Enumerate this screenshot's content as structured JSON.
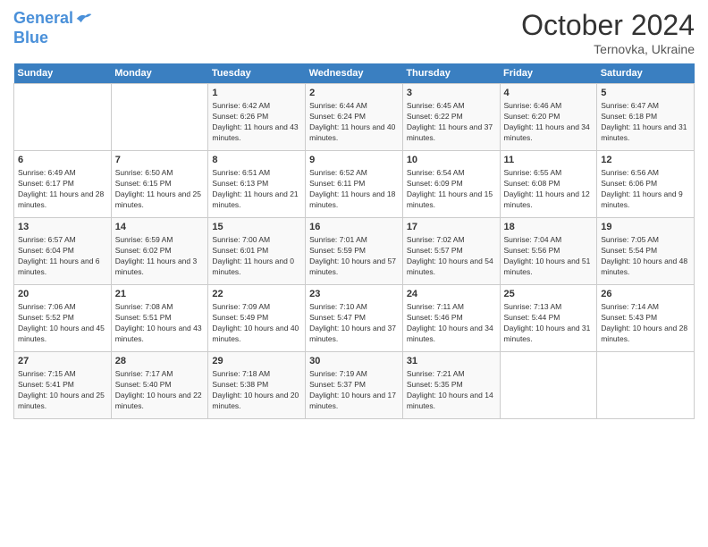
{
  "header": {
    "logo_line1": "General",
    "logo_line2": "Blue",
    "month": "October 2024",
    "location": "Ternovka, Ukraine"
  },
  "days_of_week": [
    "Sunday",
    "Monday",
    "Tuesday",
    "Wednesday",
    "Thursday",
    "Friday",
    "Saturday"
  ],
  "weeks": [
    [
      {
        "day": "",
        "info": ""
      },
      {
        "day": "",
        "info": ""
      },
      {
        "day": "1",
        "info": "Sunrise: 6:42 AM\nSunset: 6:26 PM\nDaylight: 11 hours and 43 minutes."
      },
      {
        "day": "2",
        "info": "Sunrise: 6:44 AM\nSunset: 6:24 PM\nDaylight: 11 hours and 40 minutes."
      },
      {
        "day": "3",
        "info": "Sunrise: 6:45 AM\nSunset: 6:22 PM\nDaylight: 11 hours and 37 minutes."
      },
      {
        "day": "4",
        "info": "Sunrise: 6:46 AM\nSunset: 6:20 PM\nDaylight: 11 hours and 34 minutes."
      },
      {
        "day": "5",
        "info": "Sunrise: 6:47 AM\nSunset: 6:18 PM\nDaylight: 11 hours and 31 minutes."
      }
    ],
    [
      {
        "day": "6",
        "info": "Sunrise: 6:49 AM\nSunset: 6:17 PM\nDaylight: 11 hours and 28 minutes."
      },
      {
        "day": "7",
        "info": "Sunrise: 6:50 AM\nSunset: 6:15 PM\nDaylight: 11 hours and 25 minutes."
      },
      {
        "day": "8",
        "info": "Sunrise: 6:51 AM\nSunset: 6:13 PM\nDaylight: 11 hours and 21 minutes."
      },
      {
        "day": "9",
        "info": "Sunrise: 6:52 AM\nSunset: 6:11 PM\nDaylight: 11 hours and 18 minutes."
      },
      {
        "day": "10",
        "info": "Sunrise: 6:54 AM\nSunset: 6:09 PM\nDaylight: 11 hours and 15 minutes."
      },
      {
        "day": "11",
        "info": "Sunrise: 6:55 AM\nSunset: 6:08 PM\nDaylight: 11 hours and 12 minutes."
      },
      {
        "day": "12",
        "info": "Sunrise: 6:56 AM\nSunset: 6:06 PM\nDaylight: 11 hours and 9 minutes."
      }
    ],
    [
      {
        "day": "13",
        "info": "Sunrise: 6:57 AM\nSunset: 6:04 PM\nDaylight: 11 hours and 6 minutes."
      },
      {
        "day": "14",
        "info": "Sunrise: 6:59 AM\nSunset: 6:02 PM\nDaylight: 11 hours and 3 minutes."
      },
      {
        "day": "15",
        "info": "Sunrise: 7:00 AM\nSunset: 6:01 PM\nDaylight: 11 hours and 0 minutes."
      },
      {
        "day": "16",
        "info": "Sunrise: 7:01 AM\nSunset: 5:59 PM\nDaylight: 10 hours and 57 minutes."
      },
      {
        "day": "17",
        "info": "Sunrise: 7:02 AM\nSunset: 5:57 PM\nDaylight: 10 hours and 54 minutes."
      },
      {
        "day": "18",
        "info": "Sunrise: 7:04 AM\nSunset: 5:56 PM\nDaylight: 10 hours and 51 minutes."
      },
      {
        "day": "19",
        "info": "Sunrise: 7:05 AM\nSunset: 5:54 PM\nDaylight: 10 hours and 48 minutes."
      }
    ],
    [
      {
        "day": "20",
        "info": "Sunrise: 7:06 AM\nSunset: 5:52 PM\nDaylight: 10 hours and 45 minutes."
      },
      {
        "day": "21",
        "info": "Sunrise: 7:08 AM\nSunset: 5:51 PM\nDaylight: 10 hours and 43 minutes."
      },
      {
        "day": "22",
        "info": "Sunrise: 7:09 AM\nSunset: 5:49 PM\nDaylight: 10 hours and 40 minutes."
      },
      {
        "day": "23",
        "info": "Sunrise: 7:10 AM\nSunset: 5:47 PM\nDaylight: 10 hours and 37 minutes."
      },
      {
        "day": "24",
        "info": "Sunrise: 7:11 AM\nSunset: 5:46 PM\nDaylight: 10 hours and 34 minutes."
      },
      {
        "day": "25",
        "info": "Sunrise: 7:13 AM\nSunset: 5:44 PM\nDaylight: 10 hours and 31 minutes."
      },
      {
        "day": "26",
        "info": "Sunrise: 7:14 AM\nSunset: 5:43 PM\nDaylight: 10 hours and 28 minutes."
      }
    ],
    [
      {
        "day": "27",
        "info": "Sunrise: 7:15 AM\nSunset: 5:41 PM\nDaylight: 10 hours and 25 minutes."
      },
      {
        "day": "28",
        "info": "Sunrise: 7:17 AM\nSunset: 5:40 PM\nDaylight: 10 hours and 22 minutes."
      },
      {
        "day": "29",
        "info": "Sunrise: 7:18 AM\nSunset: 5:38 PM\nDaylight: 10 hours and 20 minutes."
      },
      {
        "day": "30",
        "info": "Sunrise: 7:19 AM\nSunset: 5:37 PM\nDaylight: 10 hours and 17 minutes."
      },
      {
        "day": "31",
        "info": "Sunrise: 7:21 AM\nSunset: 5:35 PM\nDaylight: 10 hours and 14 minutes."
      },
      {
        "day": "",
        "info": ""
      },
      {
        "day": "",
        "info": ""
      }
    ]
  ]
}
